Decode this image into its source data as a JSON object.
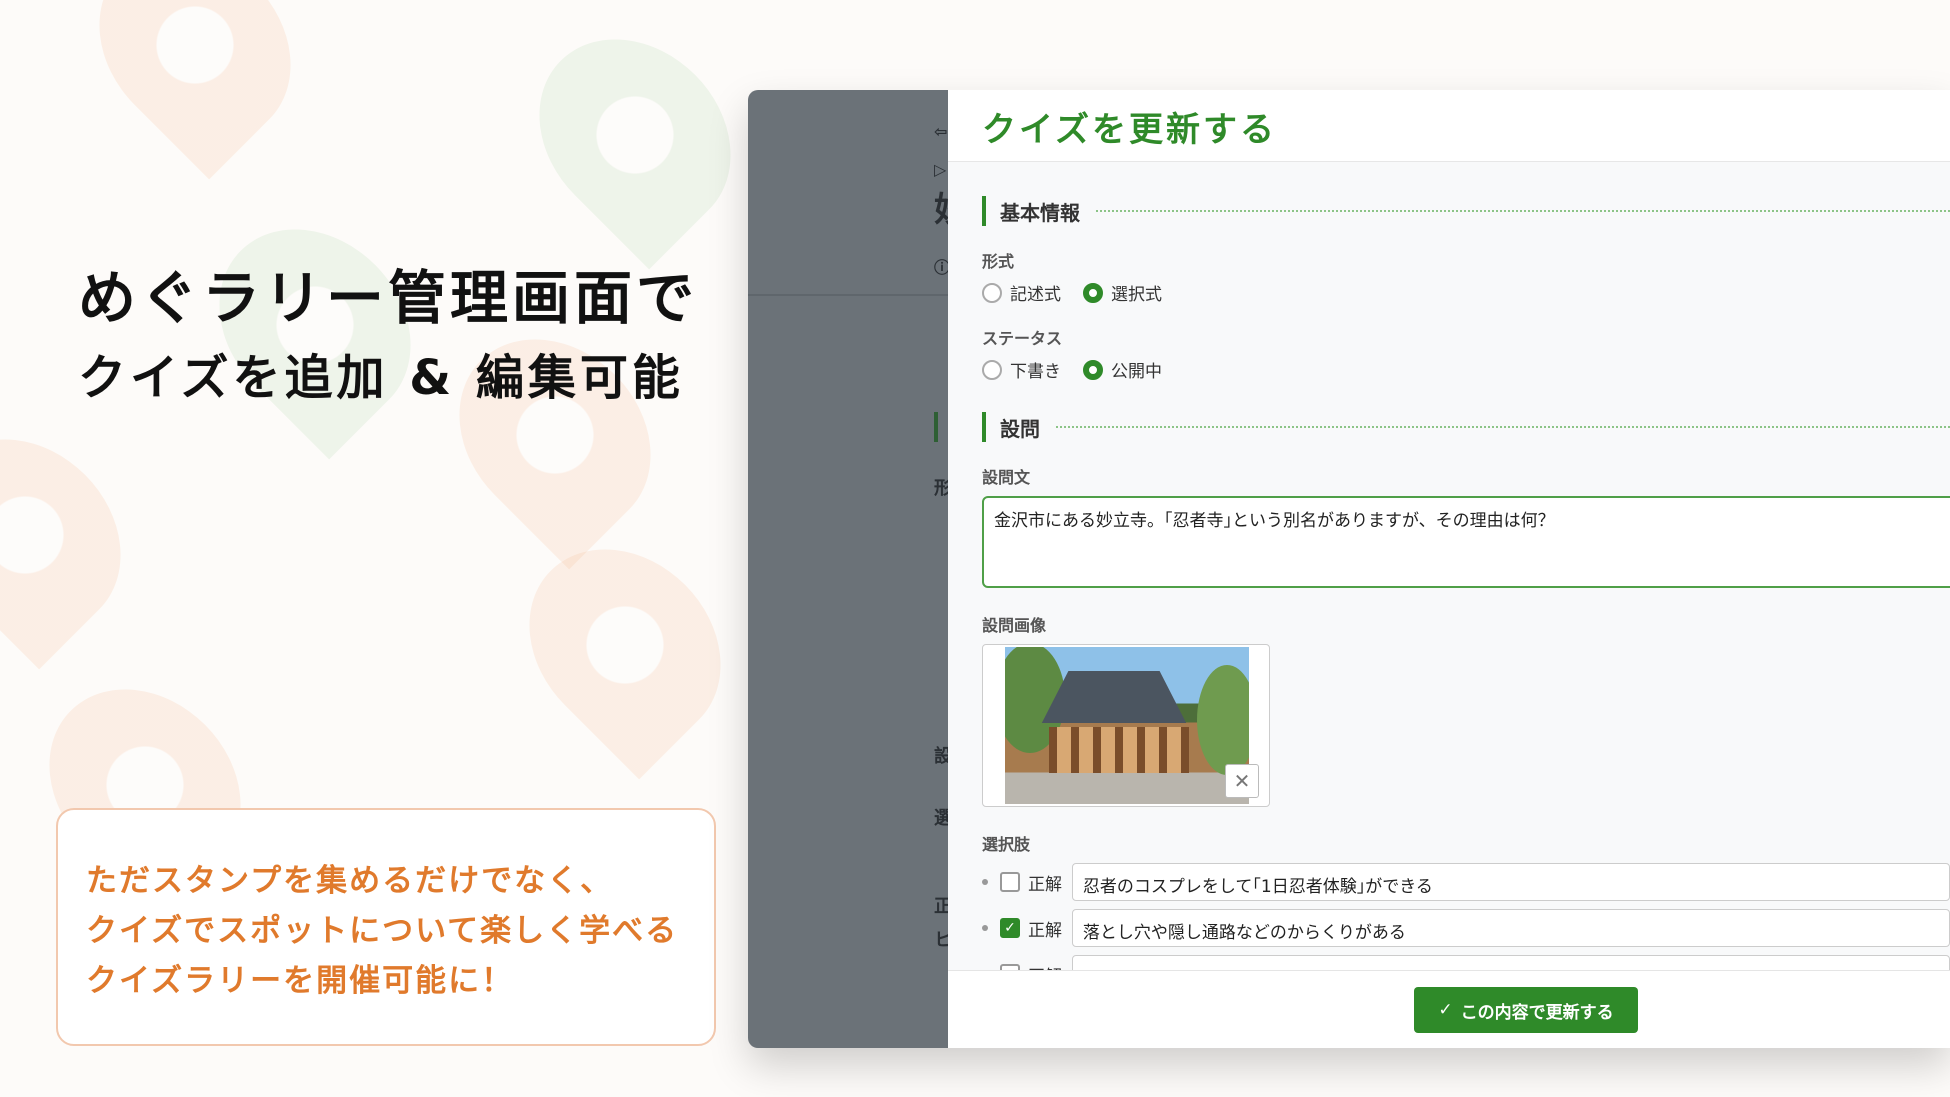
{
  "headline": {
    "line1": "めぐラリー管理画面で",
    "line2": "クイズを追加 & 編集可能"
  },
  "promo": {
    "lines": [
      "ただスタンプを集めるだけでなく、",
      "クイズでスポットについて楽しく学べる",
      "クイズラリーを開催可能に！"
    ]
  },
  "panel": {
    "title": "クイズを更新する",
    "basic_section": "基本情報",
    "format": {
      "label": "形式",
      "options": [
        "記述式",
        "選択式"
      ],
      "selected": "選択式"
    },
    "status": {
      "label": "ステータス",
      "options": [
        "下書き",
        "公開中"
      ],
      "selected": "公開中"
    },
    "question_section": "設問",
    "question_text": {
      "label": "設問文",
      "value": "金沢市にある妙立寺。｢忍者寺｣という別名がありますが、その理由は何？"
    },
    "question_image": {
      "label": "設問画像",
      "remove_icon": "close-icon"
    },
    "choices": {
      "label": "選択肢",
      "checkbox_label": "正解",
      "items": [
        {
          "text": "忍者のコスプレをして｢1日忍者体験｣ができる",
          "correct": false
        },
        {
          "text": "落とし穴や隠し通路などのからくりがある",
          "correct": true
        }
      ]
    },
    "submit_label": "この内容で更新する"
  },
  "behind": {
    "chars": [
      "⇦",
      "▷",
      "妙",
      "ⓘ",
      "形",
      "設",
      "選",
      "正",
      "ヒ"
    ]
  },
  "colors": {
    "accent": "#2f8a29",
    "promo_text": "#e07a2c",
    "overlay": "#6b7278"
  }
}
